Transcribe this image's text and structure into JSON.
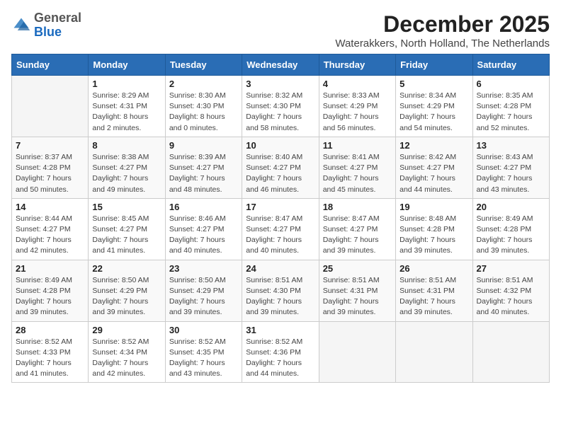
{
  "logo": {
    "general": "General",
    "blue": "Blue"
  },
  "header": {
    "month_year": "December 2025",
    "location": "Waterakkers, North Holland, The Netherlands"
  },
  "weekdays": [
    "Sunday",
    "Monday",
    "Tuesday",
    "Wednesday",
    "Thursday",
    "Friday",
    "Saturday"
  ],
  "weeks": [
    [
      {
        "day": "",
        "sunrise": "",
        "sunset": "",
        "daylight": ""
      },
      {
        "day": "1",
        "sunrise": "Sunrise: 8:29 AM",
        "sunset": "Sunset: 4:31 PM",
        "daylight": "Daylight: 8 hours and 2 minutes."
      },
      {
        "day": "2",
        "sunrise": "Sunrise: 8:30 AM",
        "sunset": "Sunset: 4:30 PM",
        "daylight": "Daylight: 8 hours and 0 minutes."
      },
      {
        "day": "3",
        "sunrise": "Sunrise: 8:32 AM",
        "sunset": "Sunset: 4:30 PM",
        "daylight": "Daylight: 7 hours and 58 minutes."
      },
      {
        "day": "4",
        "sunrise": "Sunrise: 8:33 AM",
        "sunset": "Sunset: 4:29 PM",
        "daylight": "Daylight: 7 hours and 56 minutes."
      },
      {
        "day": "5",
        "sunrise": "Sunrise: 8:34 AM",
        "sunset": "Sunset: 4:29 PM",
        "daylight": "Daylight: 7 hours and 54 minutes."
      },
      {
        "day": "6",
        "sunrise": "Sunrise: 8:35 AM",
        "sunset": "Sunset: 4:28 PM",
        "daylight": "Daylight: 7 hours and 52 minutes."
      }
    ],
    [
      {
        "day": "7",
        "sunrise": "Sunrise: 8:37 AM",
        "sunset": "Sunset: 4:28 PM",
        "daylight": "Daylight: 7 hours and 50 minutes."
      },
      {
        "day": "8",
        "sunrise": "Sunrise: 8:38 AM",
        "sunset": "Sunset: 4:27 PM",
        "daylight": "Daylight: 7 hours and 49 minutes."
      },
      {
        "day": "9",
        "sunrise": "Sunrise: 8:39 AM",
        "sunset": "Sunset: 4:27 PM",
        "daylight": "Daylight: 7 hours and 48 minutes."
      },
      {
        "day": "10",
        "sunrise": "Sunrise: 8:40 AM",
        "sunset": "Sunset: 4:27 PM",
        "daylight": "Daylight: 7 hours and 46 minutes."
      },
      {
        "day": "11",
        "sunrise": "Sunrise: 8:41 AM",
        "sunset": "Sunset: 4:27 PM",
        "daylight": "Daylight: 7 hours and 45 minutes."
      },
      {
        "day": "12",
        "sunrise": "Sunrise: 8:42 AM",
        "sunset": "Sunset: 4:27 PM",
        "daylight": "Daylight: 7 hours and 44 minutes."
      },
      {
        "day": "13",
        "sunrise": "Sunrise: 8:43 AM",
        "sunset": "Sunset: 4:27 PM",
        "daylight": "Daylight: 7 hours and 43 minutes."
      }
    ],
    [
      {
        "day": "14",
        "sunrise": "Sunrise: 8:44 AM",
        "sunset": "Sunset: 4:27 PM",
        "daylight": "Daylight: 7 hours and 42 minutes."
      },
      {
        "day": "15",
        "sunrise": "Sunrise: 8:45 AM",
        "sunset": "Sunset: 4:27 PM",
        "daylight": "Daylight: 7 hours and 41 minutes."
      },
      {
        "day": "16",
        "sunrise": "Sunrise: 8:46 AM",
        "sunset": "Sunset: 4:27 PM",
        "daylight": "Daylight: 7 hours and 40 minutes."
      },
      {
        "day": "17",
        "sunrise": "Sunrise: 8:47 AM",
        "sunset": "Sunset: 4:27 PM",
        "daylight": "Daylight: 7 hours and 40 minutes."
      },
      {
        "day": "18",
        "sunrise": "Sunrise: 8:47 AM",
        "sunset": "Sunset: 4:27 PM",
        "daylight": "Daylight: 7 hours and 39 minutes."
      },
      {
        "day": "19",
        "sunrise": "Sunrise: 8:48 AM",
        "sunset": "Sunset: 4:28 PM",
        "daylight": "Daylight: 7 hours and 39 minutes."
      },
      {
        "day": "20",
        "sunrise": "Sunrise: 8:49 AM",
        "sunset": "Sunset: 4:28 PM",
        "daylight": "Daylight: 7 hours and 39 minutes."
      }
    ],
    [
      {
        "day": "21",
        "sunrise": "Sunrise: 8:49 AM",
        "sunset": "Sunset: 4:28 PM",
        "daylight": "Daylight: 7 hours and 39 minutes."
      },
      {
        "day": "22",
        "sunrise": "Sunrise: 8:50 AM",
        "sunset": "Sunset: 4:29 PM",
        "daylight": "Daylight: 7 hours and 39 minutes."
      },
      {
        "day": "23",
        "sunrise": "Sunrise: 8:50 AM",
        "sunset": "Sunset: 4:29 PM",
        "daylight": "Daylight: 7 hours and 39 minutes."
      },
      {
        "day": "24",
        "sunrise": "Sunrise: 8:51 AM",
        "sunset": "Sunset: 4:30 PM",
        "daylight": "Daylight: 7 hours and 39 minutes."
      },
      {
        "day": "25",
        "sunrise": "Sunrise: 8:51 AM",
        "sunset": "Sunset: 4:31 PM",
        "daylight": "Daylight: 7 hours and 39 minutes."
      },
      {
        "day": "26",
        "sunrise": "Sunrise: 8:51 AM",
        "sunset": "Sunset: 4:31 PM",
        "daylight": "Daylight: 7 hours and 39 minutes."
      },
      {
        "day": "27",
        "sunrise": "Sunrise: 8:51 AM",
        "sunset": "Sunset: 4:32 PM",
        "daylight": "Daylight: 7 hours and 40 minutes."
      }
    ],
    [
      {
        "day": "28",
        "sunrise": "Sunrise: 8:52 AM",
        "sunset": "Sunset: 4:33 PM",
        "daylight": "Daylight: 7 hours and 41 minutes."
      },
      {
        "day": "29",
        "sunrise": "Sunrise: 8:52 AM",
        "sunset": "Sunset: 4:34 PM",
        "daylight": "Daylight: 7 hours and 42 minutes."
      },
      {
        "day": "30",
        "sunrise": "Sunrise: 8:52 AM",
        "sunset": "Sunset: 4:35 PM",
        "daylight": "Daylight: 7 hours and 43 minutes."
      },
      {
        "day": "31",
        "sunrise": "Sunrise: 8:52 AM",
        "sunset": "Sunset: 4:36 PM",
        "daylight": "Daylight: 7 hours and 44 minutes."
      },
      {
        "day": "",
        "sunrise": "",
        "sunset": "",
        "daylight": ""
      },
      {
        "day": "",
        "sunrise": "",
        "sunset": "",
        "daylight": ""
      },
      {
        "day": "",
        "sunrise": "",
        "sunset": "",
        "daylight": ""
      }
    ]
  ]
}
